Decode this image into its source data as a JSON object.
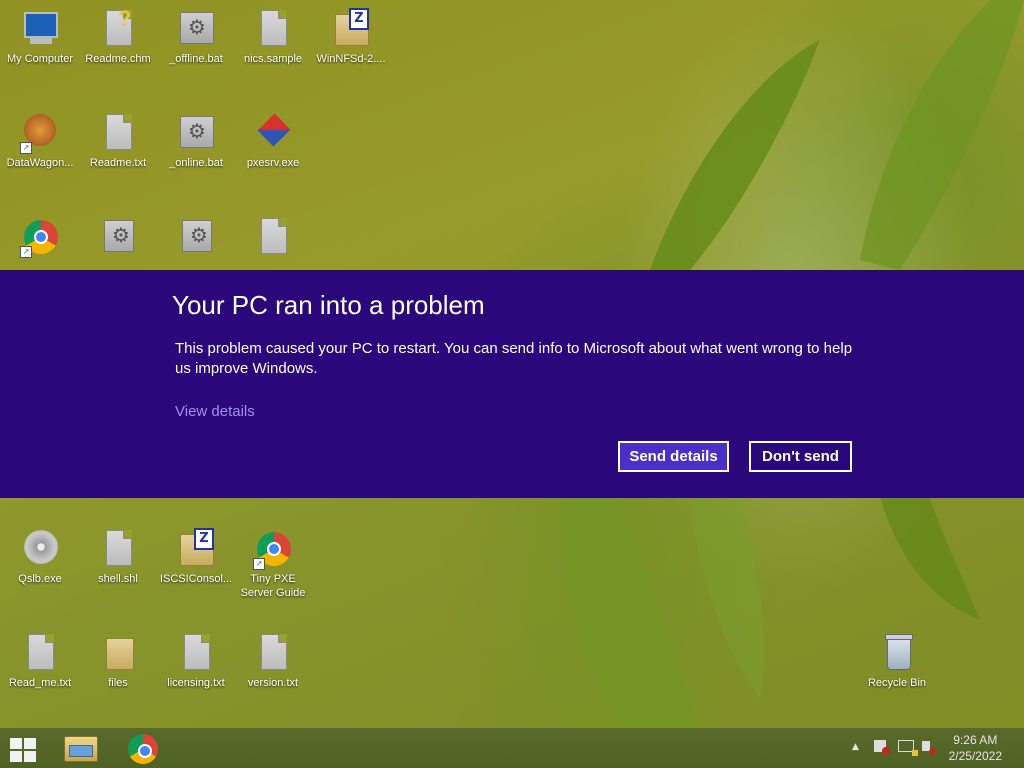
{
  "desktop": {
    "icons": [
      {
        "label": "My Computer"
      },
      {
        "label": "Readme.chm"
      },
      {
        "label": "_offline.bat"
      },
      {
        "label": "nics.sample"
      },
      {
        "label": "WinNFSd-2...."
      },
      {
        "label": "DataWagon..."
      },
      {
        "label": "Readme.txt"
      },
      {
        "label": "_online.bat"
      },
      {
        "label": "pxesrv.exe"
      },
      {
        "label": "Qslb.exe"
      },
      {
        "label": "shell.shl"
      },
      {
        "label": "ISCSIConsol..."
      },
      {
        "label": "Tiny PXE Server Guide"
      },
      {
        "label": "Read_me.txt"
      },
      {
        "label": "files"
      },
      {
        "label": "licensing.txt"
      },
      {
        "label": "version.txt"
      },
      {
        "label": "Recycle Bin"
      }
    ]
  },
  "dialog": {
    "title": "Your PC ran into a problem",
    "message": "This problem caused your PC to restart. You can send info to Microsoft about what went wrong to help us improve Windows.",
    "view_details": "View details",
    "send_label": "Send details",
    "dont_send_label": "Don't send",
    "colors": {
      "background": "#2b077c",
      "primary_button": "#4a2fc9",
      "link": "#a28ff2"
    }
  },
  "taskbar": {
    "start_icon": "windows-logo-icon",
    "pinned": [
      {
        "name": "file-explorer-icon"
      },
      {
        "name": "chrome-icon"
      }
    ],
    "tray": {
      "overflow": "▲",
      "icons": [
        "action-center-flag-icon",
        "network-icon",
        "volume-muted-icon"
      ]
    },
    "clock": {
      "time": "9:26 AM",
      "date": "2/25/2022"
    }
  }
}
